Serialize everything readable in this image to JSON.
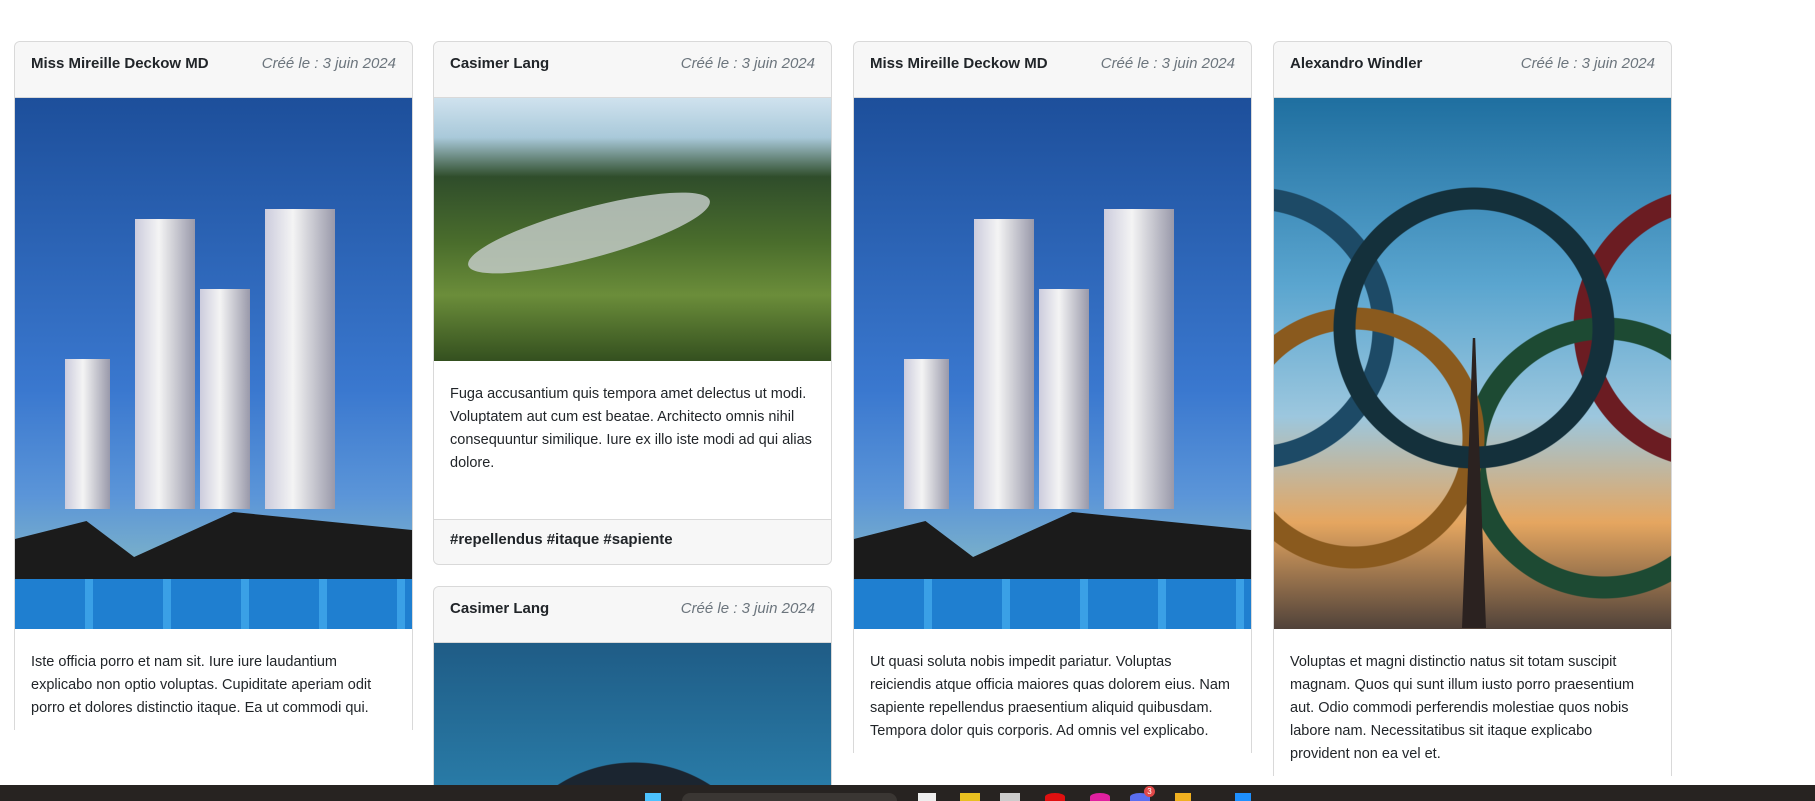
{
  "cards": [
    {
      "author": "Miss Mireille Deckow MD",
      "date": "Créé le : 3 juin 2024",
      "image": "bmx-city-skyline",
      "text": "Iste officia porro et nam sit. Iure iure laudantium explicabo non optio voluptas. Cupiditate aperiam odit porro et dolores distinctio itaque. Ea ut commodi qui."
    },
    {
      "author": "Casimer Lang",
      "date": "Créé le : 3 juin 2024",
      "image": "forest-stream",
      "text": "Fuga accusantium quis tempora amet delectus ut modi. Voluptatem aut cum est beatae. Architecto omnis nihil consequuntur similique. Iure ex illo iste modi ad qui alias dolore.",
      "tags": "#repellendus #itaque #sapiente"
    },
    {
      "author": "Casimer Lang",
      "date": "Créé le : 3 juin 2024",
      "image": "blue-dome"
    },
    {
      "author": "Miss Mireille Deckow MD",
      "date": "Créé le : 3 juin 2024",
      "image": "bmx-city-skyline",
      "text": "Ut quasi soluta nobis impedit pariatur. Voluptas reiciendis atque officia maiores quas dolorem eius. Nam sapiente repellendus praesentium aliquid quibusdam. Tempora dolor quis corporis. Ad omnis vel explicabo."
    },
    {
      "author": "Alexandro Windler",
      "date": "Créé le : 3 juin 2024",
      "image": "olympic-rings-eiffel-tower",
      "text": "Voluptas et magni distinctio natus sit totam suscipit magnam. Quos qui sunt illum iusto porro praesentium aut. Odio commodi perferendis molestiae quos nobis labore nam. Necessitatibus sit itaque explicabo provident non ea vel et."
    }
  ],
  "taskbar": {
    "notification_count": "3"
  }
}
